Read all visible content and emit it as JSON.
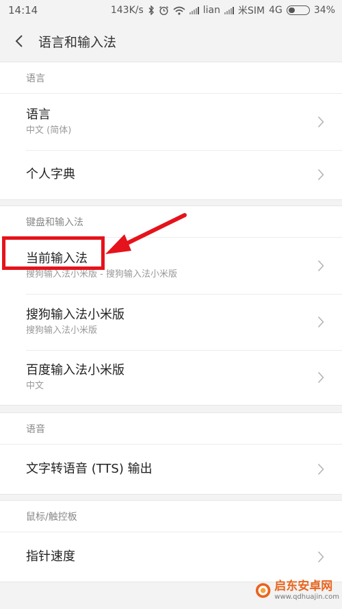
{
  "status_bar": {
    "time": "14:14",
    "speed": "143K/s",
    "carrier1": "lian",
    "carrier2": "米SIM",
    "network": "4G",
    "battery_text": "34%",
    "battery_level": 0.34
  },
  "header": {
    "title": "语言和输入法"
  },
  "sections": {
    "language": {
      "header": "语言",
      "rows": [
        {
          "title": "语言",
          "subtitle": "中文 (简体)"
        },
        {
          "title": "个人字典"
        }
      ]
    },
    "keyboard": {
      "header": "键盘和输入法",
      "rows": [
        {
          "title": "当前输入法",
          "subtitle": "搜狗输入法小米版 - 搜狗输入法小米版"
        },
        {
          "title": "搜狗输入法小米版",
          "subtitle": "搜狗输入法小米版"
        },
        {
          "title": "百度输入法小米版",
          "subtitle": "中文"
        }
      ]
    },
    "speech": {
      "header": "语音",
      "rows": [
        {
          "title": "文字转语音 (TTS) 输出"
        }
      ]
    },
    "pointer": {
      "header": "鼠标/触控板",
      "rows": [
        {
          "title": "指针速度"
        }
      ]
    }
  },
  "watermark": {
    "name": "启东安卓网",
    "url": "www.qdhuajin.com"
  },
  "colors": {
    "background": "#f3f3f3",
    "highlight": "#e5131b",
    "watermark_accent": "#e8641e"
  },
  "icons": {
    "back": "chevron-left-icon",
    "row_arrow": "chevron-right-icon",
    "bluetooth": "bluetooth-icon",
    "alarm": "alarm-clock-icon",
    "wifi": "wifi-icon"
  }
}
